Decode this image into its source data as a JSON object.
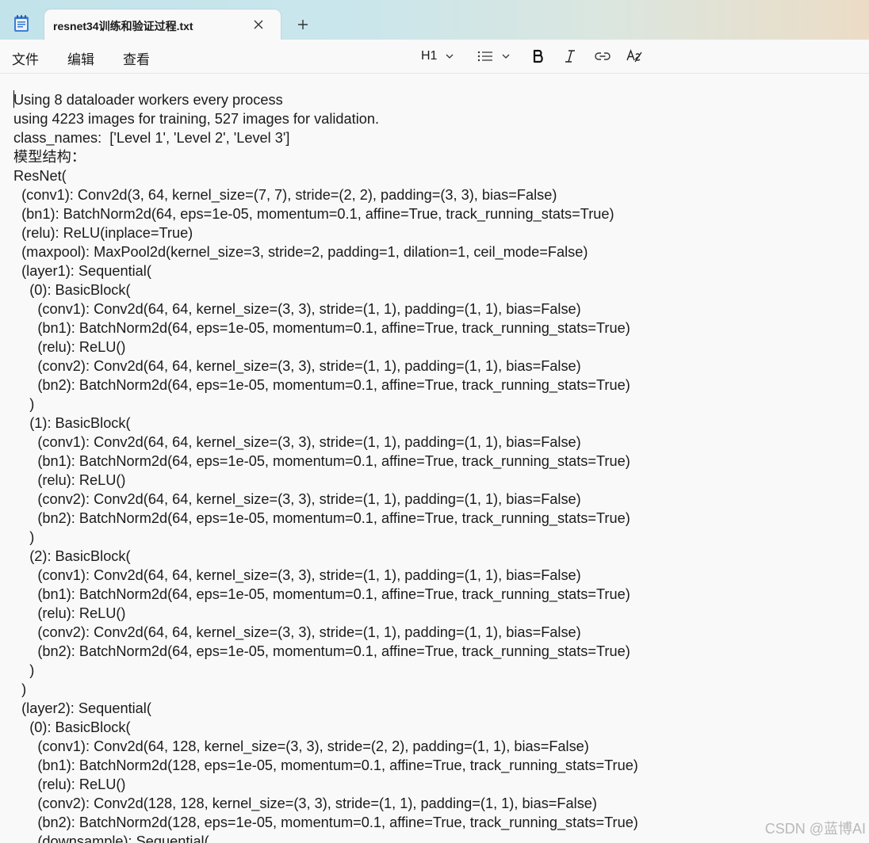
{
  "tab": {
    "title": "resnet34训练和验证过程.txt"
  },
  "menu": {
    "file": "文件",
    "edit": "编辑",
    "view": "查看"
  },
  "toolbar": {
    "heading": "H1"
  },
  "icons": {
    "app": "notepad-icon",
    "close": "close-icon",
    "new_tab": "plus-icon",
    "heading_dropdown": "chevron-down-icon",
    "list": "list-icon",
    "bold": "bold-icon",
    "italic": "italic-icon",
    "link": "link-icon",
    "clear_format": "clear-formatting-icon"
  },
  "document": {
    "lines": [
      "Using 8 dataloader workers every process",
      "using 4223 images for training, 527 images for validation.",
      "class_names:  ['Level 1', 'Level 2', 'Level 3']",
      "模型结构：",
      "ResNet(",
      "  (conv1): Conv2d(3, 64, kernel_size=(7, 7), stride=(2, 2), padding=(3, 3), bias=False)",
      "  (bn1): BatchNorm2d(64, eps=1e-05, momentum=0.1, affine=True, track_running_stats=True)",
      "  (relu): ReLU(inplace=True)",
      "  (maxpool): MaxPool2d(kernel_size=3, stride=2, padding=1, dilation=1, ceil_mode=False)",
      "  (layer1): Sequential(",
      "    (0): BasicBlock(",
      "      (conv1): Conv2d(64, 64, kernel_size=(3, 3), stride=(1, 1), padding=(1, 1), bias=False)",
      "      (bn1): BatchNorm2d(64, eps=1e-05, momentum=0.1, affine=True, track_running_stats=True)",
      "      (relu): ReLU()",
      "      (conv2): Conv2d(64, 64, kernel_size=(3, 3), stride=(1, 1), padding=(1, 1), bias=False)",
      "      (bn2): BatchNorm2d(64, eps=1e-05, momentum=0.1, affine=True, track_running_stats=True)",
      "    )",
      "    (1): BasicBlock(",
      "      (conv1): Conv2d(64, 64, kernel_size=(3, 3), stride=(1, 1), padding=(1, 1), bias=False)",
      "      (bn1): BatchNorm2d(64, eps=1e-05, momentum=0.1, affine=True, track_running_stats=True)",
      "      (relu): ReLU()",
      "      (conv2): Conv2d(64, 64, kernel_size=(3, 3), stride=(1, 1), padding=(1, 1), bias=False)",
      "      (bn2): BatchNorm2d(64, eps=1e-05, momentum=0.1, affine=True, track_running_stats=True)",
      "    )",
      "    (2): BasicBlock(",
      "      (conv1): Conv2d(64, 64, kernel_size=(3, 3), stride=(1, 1), padding=(1, 1), bias=False)",
      "      (bn1): BatchNorm2d(64, eps=1e-05, momentum=0.1, affine=True, track_running_stats=True)",
      "      (relu): ReLU()",
      "      (conv2): Conv2d(64, 64, kernel_size=(3, 3), stride=(1, 1), padding=(1, 1), bias=False)",
      "      (bn2): BatchNorm2d(64, eps=1e-05, momentum=0.1, affine=True, track_running_stats=True)",
      "    )",
      "  )",
      "  (layer2): Sequential(",
      "    (0): BasicBlock(",
      "      (conv1): Conv2d(64, 128, kernel_size=(3, 3), stride=(2, 2), padding=(1, 1), bias=False)",
      "      (bn1): BatchNorm2d(128, eps=1e-05, momentum=0.1, affine=True, track_running_stats=True)",
      "      (relu): ReLU()",
      "      (conv2): Conv2d(128, 128, kernel_size=(3, 3), stride=(1, 1), padding=(1, 1), bias=False)",
      "      (bn2): BatchNorm2d(128, eps=1e-05, momentum=0.1, affine=True, track_running_stats=True)",
      "      (downsample): Sequential("
    ]
  },
  "watermark": "CSDN @蓝博AI"
}
